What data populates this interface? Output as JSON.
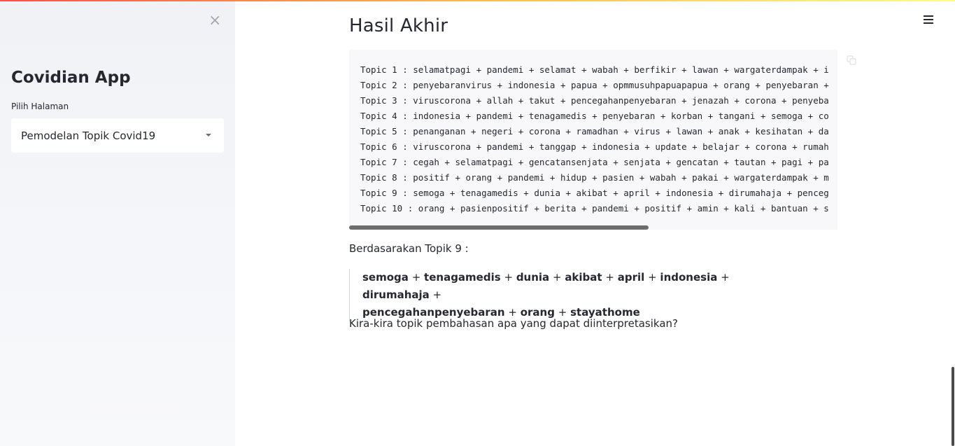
{
  "sidebar": {
    "close_glyph": "×",
    "app_title": "Covidian App",
    "select_label": "Pilih Halaman",
    "select_value": "Pemodelan Topik Covid19"
  },
  "main": {
    "heading": "Hasil Akhir",
    "topics": [
      "Topic 1 : selamatpagi + pandemi + selamat + wabah + berfikir + lawan + wargaterdampak + i",
      "Topic 2 : penyebaranvirus + indonesia + papua + opmmusuhpapuapapua + orang + penyebaran +",
      "Topic 3 : viruscorona + allah + takut + pencegahanpenyebaran + jenazah + corona + penyeba",
      "Topic 4 : indonesia + pandemi + tenagamedis + penyebaran + korban + tangani + semoga + co",
      "Topic 5 : penanganan + negeri + corona + ramadhan + virus + lawan + anak + kesihatan + da",
      "Topic 6 : viruscorona + pandemi + tanggap + indonesia + update + belajar + corona + rumah",
      "Topic 7 : cegah + selamatpagi + gencatansenjata + senjata + gencatan + tautan + pagi + pa",
      "Topic 8 : positif + orang + pandemi + hidup + pasien + wabah + pakai + wargaterdampak + m",
      "Topic 9 : semoga + tenagamedis + dunia + akibat + april + indonesia + dirumahaja + penceg",
      "Topic 10 : orang + pasienpositif + berita + pandemi + positif + amin + kali + bantuan + s"
    ],
    "intro": "Berdasarakan Topik 9 :",
    "topic9_terms": [
      "semoga",
      "tenagamedis",
      "dunia",
      "akibat",
      "april",
      "indonesia",
      "dirumahaja",
      "pencegahanpenyebaran",
      "orang",
      "stayathome"
    ],
    "plus": "+",
    "question": "Kira-kira topik pembahasan apa yang dapat diinterpretasikan?"
  },
  "icons": {
    "close": "close-icon",
    "hamburger": "hamburger-menu-icon",
    "copy": "copy-icon",
    "dropdown": "chevron-down-icon"
  },
  "colors": {
    "accent_gradient_start": "#ff4b4b",
    "accent_gradient_end": "#fffd80",
    "sidebar_bg": "#f0f2f6",
    "code_bg": "#f8f8fa",
    "text": "#262730"
  }
}
